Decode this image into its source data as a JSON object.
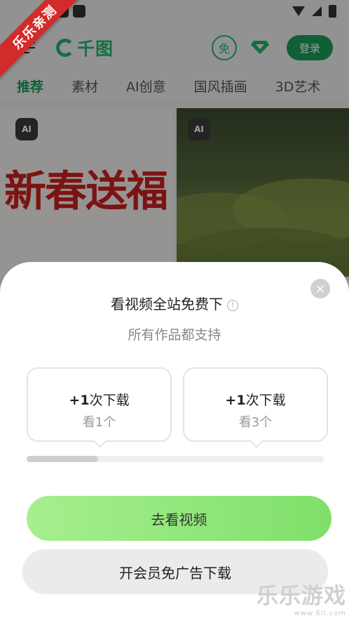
{
  "header": {
    "logo_text": "千图",
    "free_label": "免",
    "login_label": "登录"
  },
  "tabs": [
    {
      "label": "推荐",
      "active": true
    },
    {
      "label": "素材",
      "active": false
    },
    {
      "label": "AI创意",
      "active": false
    },
    {
      "label": "国风插画",
      "active": false
    },
    {
      "label": "3D艺术",
      "active": false
    }
  ],
  "cards": {
    "badge": "AI",
    "left_text": "新春送福"
  },
  "ribbon": "乐乐亲测",
  "sheet": {
    "close_label": "×",
    "title": "看视频全站免费下",
    "info_label": "!",
    "subtitle": "所有作品都支持",
    "rewards": [
      {
        "bold": "+1",
        "title": "次下载",
        "sub": "看1个"
      },
      {
        "bold": "+1",
        "title": "次下载",
        "sub": "看3个"
      }
    ],
    "progress_percent": 24,
    "primary_button": "去看视频",
    "secondary_button": "开会员免广告下载"
  },
  "watermark": {
    "main": "乐乐游戏",
    "url": "www.6ll.com"
  },
  "colors": {
    "brand_green": "#22b46c",
    "login_green": "#1c9a5a",
    "primary_btn_from": "#a6ef8e",
    "primary_btn_to": "#7fe06a",
    "ribbon_red": "#d32a2a"
  }
}
